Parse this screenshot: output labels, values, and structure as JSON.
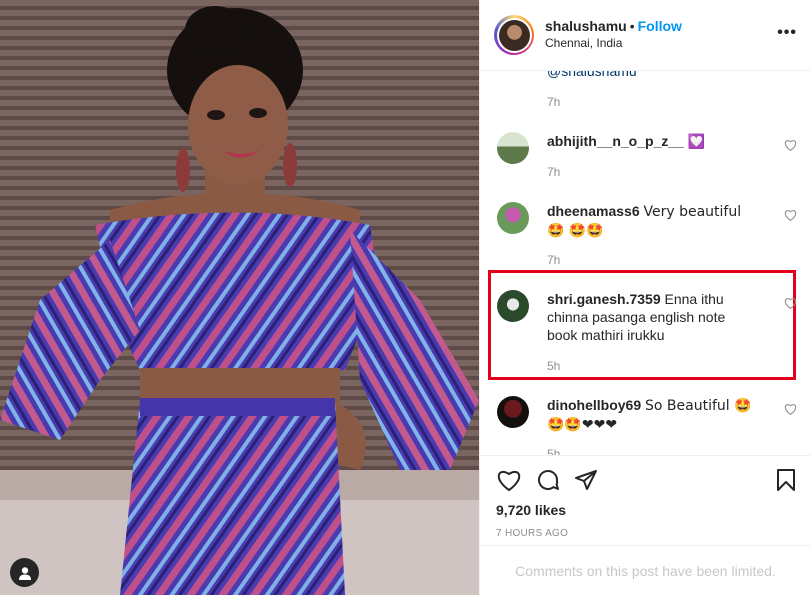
{
  "post": {
    "username": "shalushamu",
    "separator": "•",
    "follow_label": "Follow",
    "location": "Chennai, India",
    "more_label": "•••"
  },
  "comments": {
    "partial_mention": "@shalushamu",
    "partial_time": "7h",
    "items": [
      {
        "user": "abhijith__n_o_p_z__",
        "text": "💟",
        "time": "7h"
      },
      {
        "user": "dheenamass6",
        "text": "Very beautiful 🤩 🤩🤩",
        "time": "7h"
      },
      {
        "user": "shri.ganesh.7359",
        "text": "Enna ithu chinna pasanga english note book mathiri irukku",
        "time": "5h"
      },
      {
        "user": "dinohellboy69",
        "text": "So Beautiful 🤩 🤩🤩❤❤❤",
        "time": "5h"
      }
    ]
  },
  "stats": {
    "likes": "9,720 likes",
    "time_ago": "7 HOURS AGO"
  },
  "footer": {
    "limited_text": "Comments on this post have been limited."
  },
  "icons": {
    "heart": "heart-icon",
    "comment": "comment-icon",
    "share": "share-icon",
    "bookmark": "bookmark-icon",
    "tag": "user-tag-icon"
  },
  "colors": {
    "follow": "#0095f6",
    "highlight": "#e3001b",
    "muted": "#8e8e8e"
  }
}
